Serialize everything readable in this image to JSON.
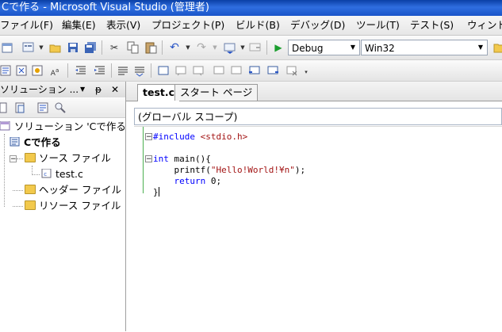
{
  "window": {
    "title": "Cで作る - Microsoft Visual Studio (管理者)"
  },
  "menu": [
    "ファイル(F)",
    "編集(E)",
    "表示(V)",
    "プロジェクト(P)",
    "ビルド(B)",
    "デバッグ(D)",
    "ツール(T)",
    "テスト(S)",
    "ウィンド"
  ],
  "toolbar": {
    "config": "Debug",
    "platform": "Win32"
  },
  "solution_explorer": {
    "title": "ソリューション ...",
    "pin_glyph": "ᵽ",
    "close_glyph": "✕",
    "tree": {
      "solution": "ソリューション 'Cで作る' (",
      "project": "Cで作る",
      "source_folder": "ソース ファイル",
      "file": "test.c",
      "header_folder": "ヘッダー ファイル",
      "resource_folder": "リソース ファイル"
    }
  },
  "editor": {
    "tabs": [
      "test.c",
      "スタート ページ"
    ],
    "scope": "(グローバル スコープ)",
    "code": {
      "l1_pp": "#include",
      "l1_hdr": " <stdio.h>",
      "l2_kw": "int",
      "l2_rest": " main(){",
      "l3_a": "    printf(",
      "l3_str": "\"Hello!World!¥n\"",
      "l3_b": ");",
      "l4_kw": "    return",
      "l4_rest": " 0;",
      "l5": "}"
    }
  }
}
